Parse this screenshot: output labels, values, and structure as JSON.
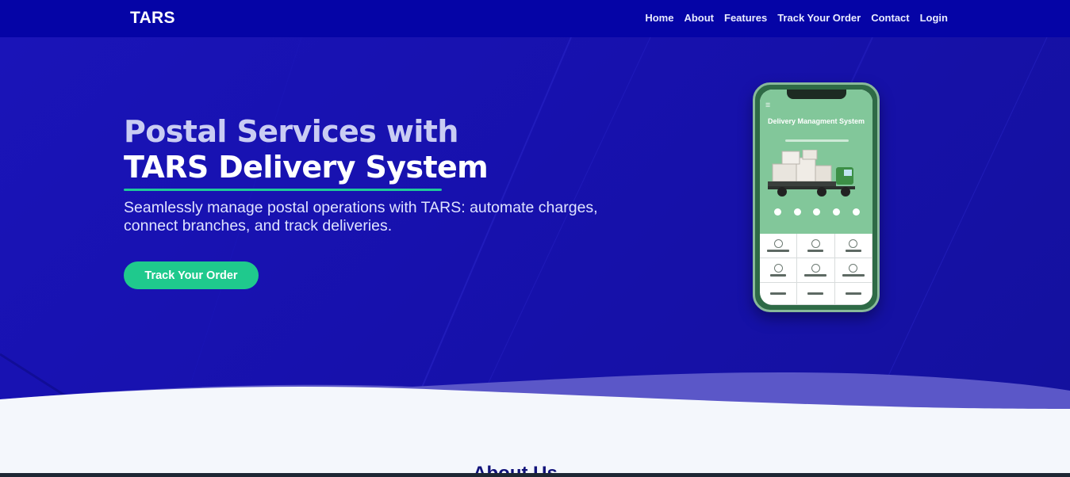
{
  "nav": {
    "brand": "TARS",
    "links": [
      "Home",
      "About",
      "Features",
      "Track Your Order",
      "Contact",
      "Login"
    ]
  },
  "hero": {
    "title_line1": "Postal Services with",
    "title_line2": "TARS Delivery System",
    "subtitle": "Seamlessly manage postal operations with TARS: automate charges, connect branches, and track deliveries.",
    "cta_label": "Track Your Order"
  },
  "phone": {
    "screen_title": "Delivery Managment System"
  },
  "about": {
    "title": "About Us"
  },
  "colors": {
    "nav_bg": "#0504a6",
    "hero_bg": "#1812b2",
    "accent": "#1fc98d",
    "phone_screen": "#82c79a",
    "section_bg": "#f4f7fc"
  }
}
